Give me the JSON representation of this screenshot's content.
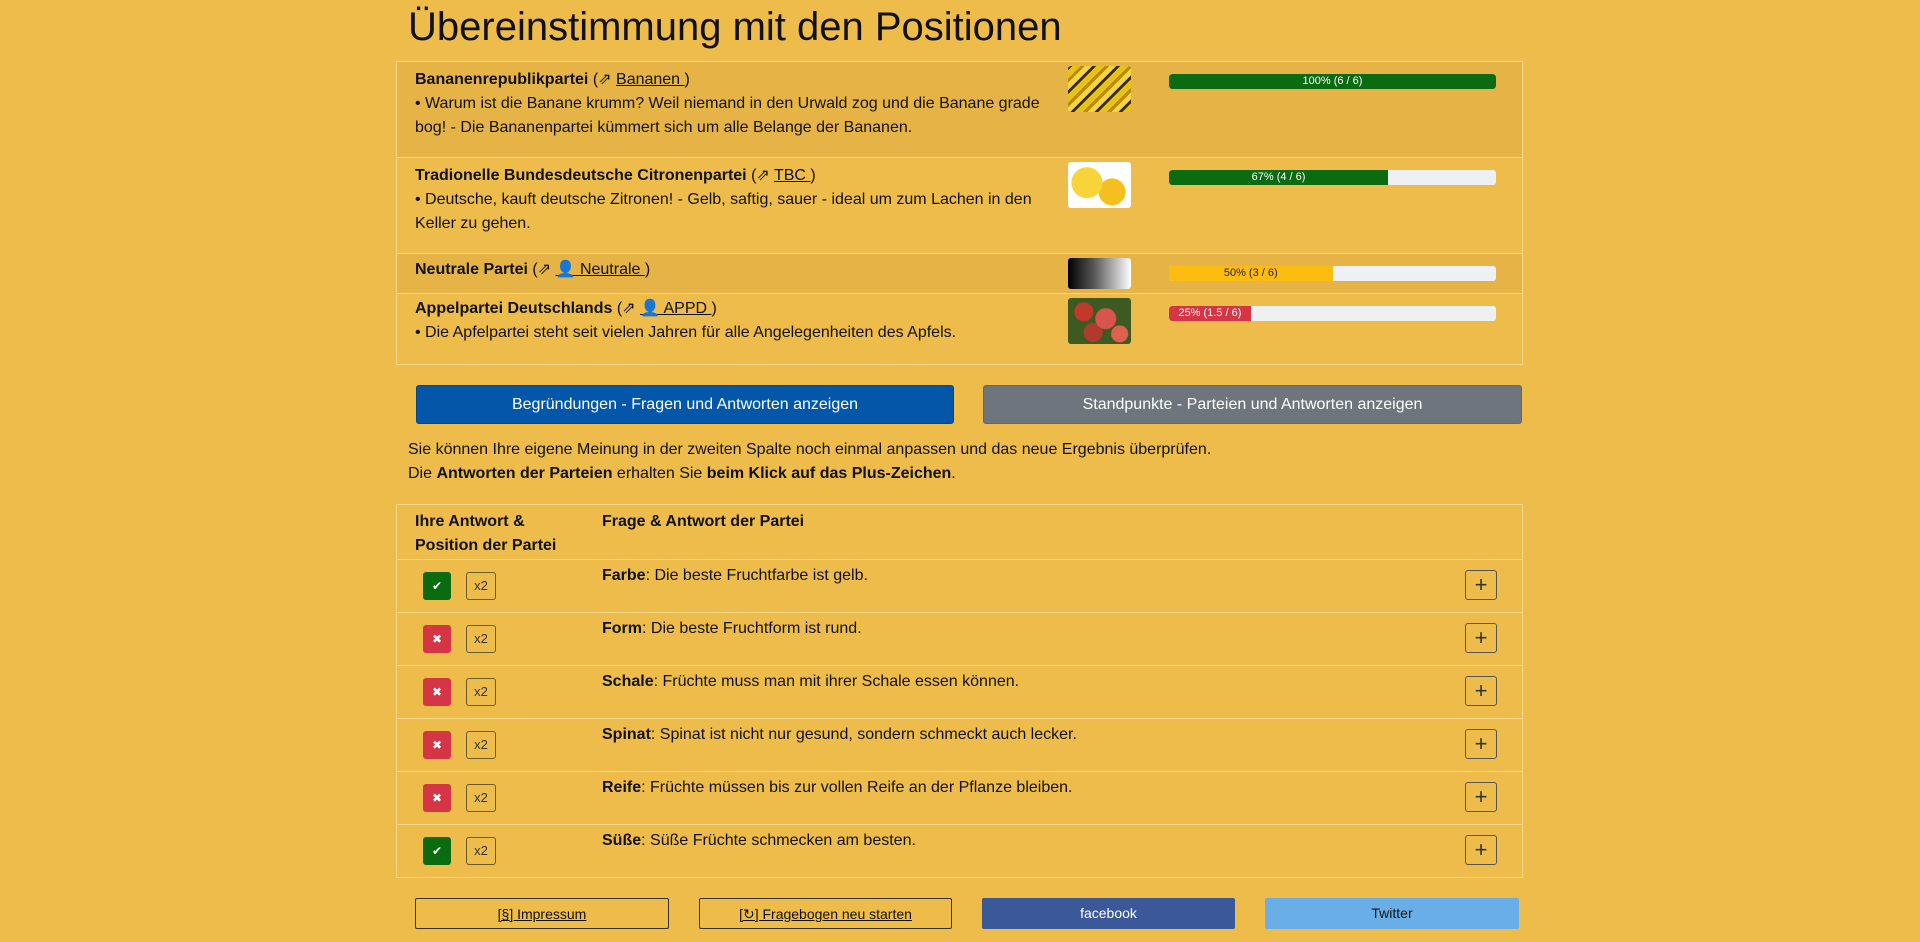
{
  "title": "Übereinstimmung mit den Positionen",
  "parties": [
    {
      "name": "Bananenrepublikpartei",
      "link_prefix": "(⇗ ",
      "link": "Bananen  ",
      "link_suffix": ")",
      "desc": "• Warum ist die Banane krumm? Weil niemand in den Urwald zog und die Banane grade bog! - Die Bananenpartei kümmert sich um alle Belange der Bananen.",
      "image": "bananas-image",
      "score_label": "100% (6 / 6)",
      "score_percent": 100,
      "bar_color": "#0a6b10"
    },
    {
      "name": "Tradionelle Bundesdeutsche Citronenpartei",
      "link_prefix": "(⇗ ",
      "link": "TBC   ",
      "link_suffix": ")",
      "desc": "• Deutsche, kauft deutsche Zitronen! - Gelb, saftig, sauer - ideal um zum Lachen in den Keller zu gehen.",
      "image": "lemons-image",
      "score_label": "67% (4 / 6)",
      "score_percent": 67,
      "bar_color": "#0a6b10"
    },
    {
      "name": "Neutrale Partei",
      "link_prefix": "(⇗ ",
      "link": "👤 Neutrale ",
      "link_suffix": ")",
      "desc": "",
      "image": "gradient-image",
      "score_label": "50% (3 / 6)",
      "score_percent": 50,
      "bar_color": "#fdbc10"
    },
    {
      "name": "Appelpartei Deutschlands",
      "link_prefix": "(⇗ ",
      "link": "👤 APPD  ",
      "link_suffix": ")",
      "desc": "• Die Apfelpartei steht seit vielen Jahren für alle Angelegenheiten des Apfels.",
      "image": "apples-image",
      "score_label": "25% (1.5 / 6)",
      "score_percent": 25,
      "bar_color": "#d63545"
    }
  ],
  "buttons": {
    "reasons": "Begründungen - Fragen und Antworten anzeigen",
    "positions": "Standpunkte - Parteien und Antworten anzeigen"
  },
  "info": {
    "line1": "Sie können Ihre eigene Meinung in der zweiten Spalte noch einmal anpassen und das neue Ergebnis überprüfen.",
    "line2_pre": "Die ",
    "line2_b1": "Antworten der Parteien",
    "line2_mid": " erhalten Sie ",
    "line2_b2": "beim Klick auf das Plus-Zeichen",
    "line2_post": "."
  },
  "table": {
    "col1_line1": "Ihre Antwort &",
    "col1_line2": "Position der Partei",
    "col2": "Frage & Antwort der Partei",
    "rows": [
      {
        "answer": "yes",
        "symbol": "✔",
        "weight": "x2",
        "topic": "Farbe",
        "question": ": Die beste Fruchtfarbe ist gelb."
      },
      {
        "answer": "no",
        "symbol": "✖",
        "weight": "x2",
        "topic": "Form",
        "question": ": Die beste Fruchtform ist rund."
      },
      {
        "answer": "no",
        "symbol": "✖",
        "weight": "x2",
        "topic": "Schale",
        "question": ": Früchte muss man mit ihrer Schale essen können."
      },
      {
        "answer": "no",
        "symbol": "✖",
        "weight": "x2",
        "topic": "Spinat",
        "question": ": Spinat ist nicht nur gesund, sondern schmeckt auch lecker."
      },
      {
        "answer": "no",
        "symbol": "✖",
        "weight": "x2",
        "topic": "Reife",
        "question": ": Früchte müssen bis zur vollen Reife an der Pflanze bleiben."
      },
      {
        "answer": "yes",
        "symbol": "✔",
        "weight": "x2",
        "topic": "Süße",
        "question": ": Süße Früchte schmecken am besten."
      }
    ],
    "plus": "+"
  },
  "footer": {
    "impressum": "[§] Impressum",
    "restart": "[↻] Fragebogen neu starten",
    "facebook": "facebook",
    "twitter": "Twitter"
  },
  "colors": {
    "background": "#EDBC4B",
    "primary_button": "#0356A8",
    "secondary_button": "#6E757C",
    "yes": "#0a6b10",
    "no": "#d63545",
    "facebook": "#3B5998",
    "twitter": "#6AAEE8"
  }
}
